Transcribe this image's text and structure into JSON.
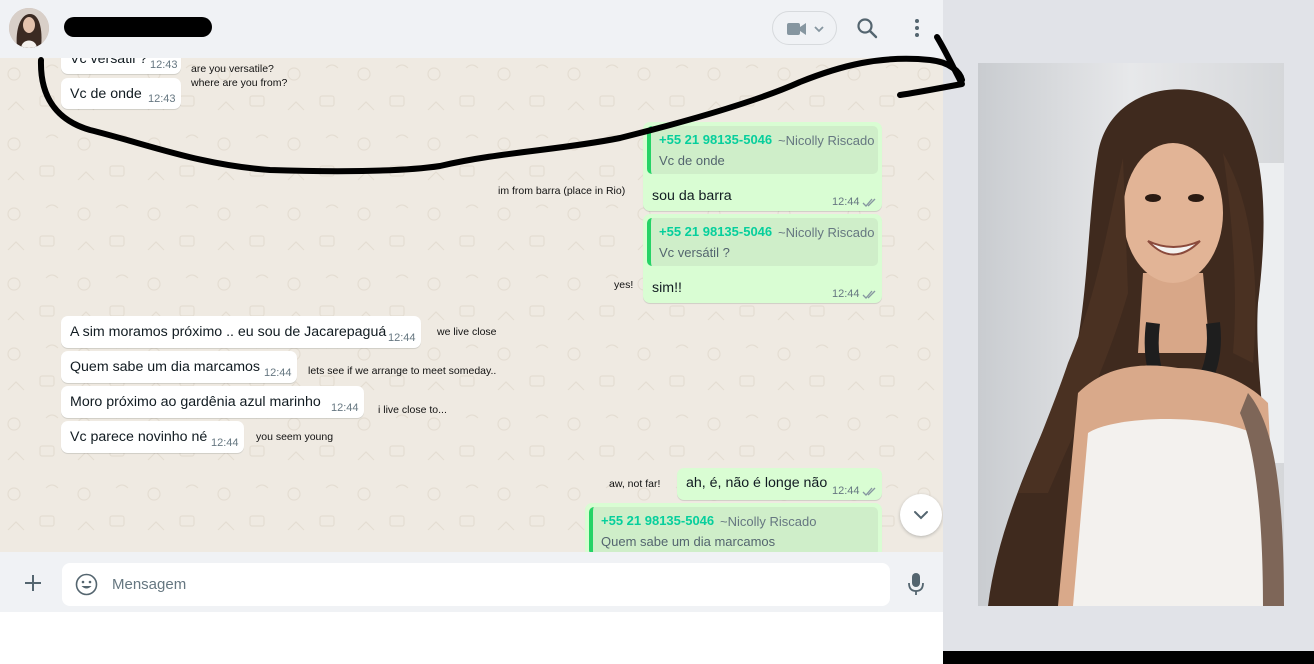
{
  "header": {
    "contact_name_redacted": true,
    "video_icon": "video-camera-icon",
    "search_icon": "search-icon",
    "menu_icon": "menu-dots-icon"
  },
  "messages": {
    "m1": {
      "text": "Vc versátil ?",
      "time": "12:43"
    },
    "m2": {
      "text": "Vc de onde",
      "time": "12:43"
    },
    "m3": {
      "quote_number": "+55 21 98135-5046",
      "quote_name": "~Nicolly Riscado",
      "quote_text": "Vc de onde",
      "text": "sou da barra",
      "time": "12:44"
    },
    "m4": {
      "quote_number": "+55 21 98135-5046",
      "quote_name": "~Nicolly Riscado",
      "quote_text": "Vc versátil ?",
      "text": "sim!!",
      "time": "12:44"
    },
    "m5": {
      "text": "A sim moramos próximo .. eu sou de Jacarepaguá",
      "time": "12:44"
    },
    "m6": {
      "text": "Quem sabe um dia marcamos",
      "time": "12:44"
    },
    "m7": {
      "text": "Moro próximo ao gardênia azul marinho",
      "time": "12:44"
    },
    "m8": {
      "text": "Vc parece novinho né",
      "time": "12:44"
    },
    "m9": {
      "text": "ah, é, não é longe não",
      "time": "12:44"
    },
    "m10": {
      "quote_number": "+55 21 98135-5046",
      "quote_name": "~Nicolly Riscado",
      "quote_text": "Quem sabe um dia marcamos"
    }
  },
  "annotations": {
    "a1": "are you versatile?",
    "a2": "where are you from?",
    "a3": "im from barra (place in Rio)",
    "a4": "yes!",
    "a5": "we live close",
    "a6": "lets see if we arrange to meet someday..",
    "a7": "i live close to...",
    "a8": "you seem young",
    "a9": "aw, not far!"
  },
  "composer": {
    "placeholder": "Mensagem",
    "plus_icon": "plus-icon",
    "emoji_icon": "emoji-icon",
    "mic_icon": "microphone-icon"
  },
  "colors": {
    "header_bg": "#f0f2f5",
    "chat_bg": "#efeae2",
    "incoming_bubble": "#ffffff",
    "outgoing_bubble": "#d9fdd3",
    "quote_accent": "#25d366",
    "quote_number": "#06cf9c",
    "ticks": "#8696a0",
    "annotation_stroke": "#000000"
  }
}
